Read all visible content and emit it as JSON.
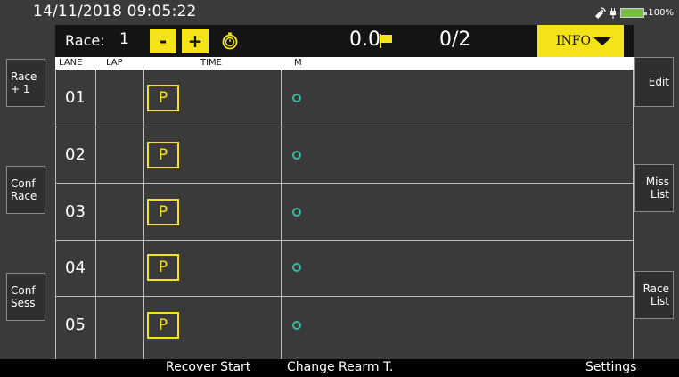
{
  "status": {
    "datetime": "14/11/2018  09:05:22",
    "battery_pct": "100%"
  },
  "race_bar": {
    "race_label": "Race:",
    "race_number": "1",
    "minus_label": "-",
    "plus_label": "+",
    "time_value": "0.0",
    "lap_count": "0/2",
    "info_label": "INFO"
  },
  "columns": {
    "lane": "LANE",
    "lap": "LAP",
    "time": "TIME",
    "m": "M"
  },
  "lanes": [
    {
      "lane": "01",
      "lap": "",
      "time_badge": "P"
    },
    {
      "lane": "02",
      "lap": "",
      "time_badge": "P"
    },
    {
      "lane": "03",
      "lap": "",
      "time_badge": "P"
    },
    {
      "lane": "04",
      "lap": "",
      "time_badge": "P"
    },
    {
      "lane": "05",
      "lap": "",
      "time_badge": "P"
    }
  ],
  "left_buttons": [
    {
      "line1": "Race",
      "line2": "+ 1"
    },
    {
      "line1": "Conf",
      "line2": "Race"
    },
    {
      "line1": "Conf",
      "line2": "Sess"
    }
  ],
  "right_buttons": [
    {
      "line1": "Edit",
      "line2": ""
    },
    {
      "line1": "Miss",
      "line2": "List"
    },
    {
      "line1": "Race",
      "line2": "List"
    }
  ],
  "footer": {
    "recover_start": "Recover Start",
    "change_rearm": "Change Rearm T.",
    "settings": "Settings"
  },
  "colors": {
    "accent_yellow": "#f5e31a",
    "status_teal": "#3fb8a0",
    "battery_green": "#77c043",
    "background": "#3a3a3a"
  },
  "icons": [
    "stopwatch-icon",
    "flag-icon",
    "satellite-icon",
    "plug-icon",
    "battery-icon",
    "caret-down-icon"
  ]
}
